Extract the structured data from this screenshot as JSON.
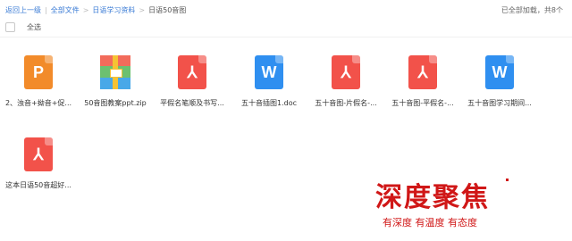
{
  "breadcrumb": {
    "back": "返回上一级",
    "all_files": "全部文件",
    "folder": "日语学习资料",
    "current": "日语50音图"
  },
  "status_text": "已全部加载，共8个",
  "select_all_label": "全选",
  "files": [
    {
      "name": "2、浊音+拗音+促...",
      "type": "ppt",
      "icon": "ppt-file-icon",
      "glyph": "P"
    },
    {
      "name": "50音图教案ppt.zip",
      "type": "zip",
      "icon": "zip-archive-icon",
      "glyph": ""
    },
    {
      "name": "平假名笔顺及书写...",
      "type": "pdf",
      "icon": "pdf-file-icon",
      "glyph": "⅄"
    },
    {
      "name": "五十音插图1.doc",
      "type": "word",
      "icon": "word-file-icon",
      "glyph": "W"
    },
    {
      "name": "五十音图-片假名-...",
      "type": "pdf",
      "icon": "pdf-file-icon",
      "glyph": "⅄"
    },
    {
      "name": "五十音图-平假名-...",
      "type": "pdf",
      "icon": "pdf-file-icon",
      "glyph": "⅄"
    },
    {
      "name": "五十音图学习期间...",
      "type": "word",
      "icon": "word-file-icon",
      "glyph": "W"
    },
    {
      "name": "这本日语50音超好...",
      "type": "pdf",
      "icon": "pdf-file-icon",
      "glyph": "⅄"
    }
  ],
  "brand": {
    "title": "深度聚焦",
    "subtitle": "有深度 有温度 有态度"
  },
  "colors": {
    "link": "#3a7bd5",
    "ppt": "#f28b2a",
    "pdf": "#f2524a",
    "word": "#2f8ff0",
    "brand": "#d01717"
  }
}
